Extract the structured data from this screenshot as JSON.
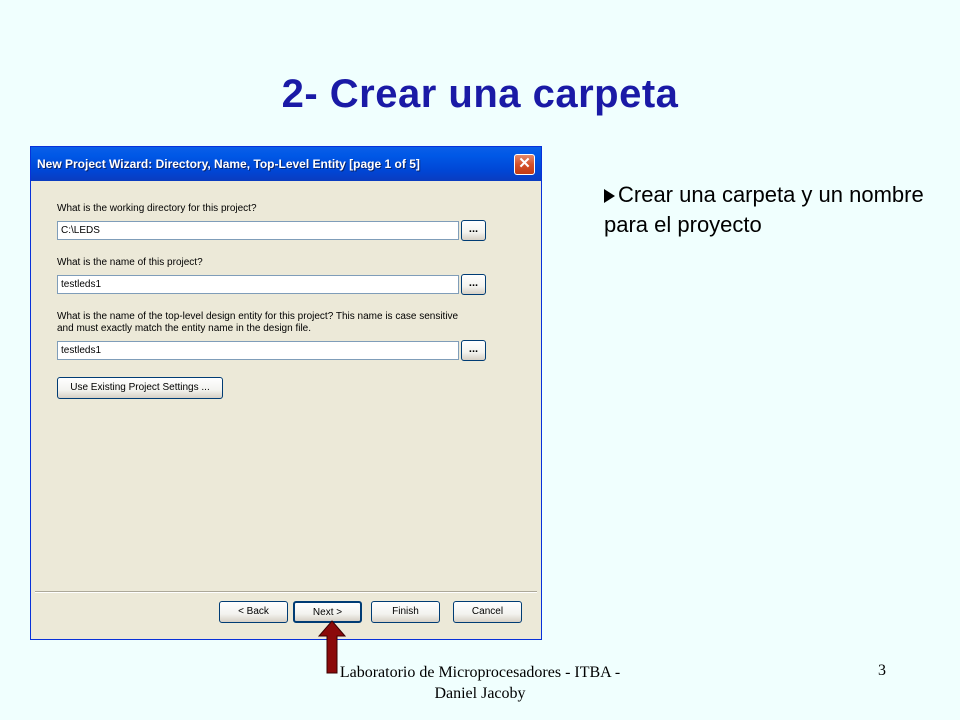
{
  "slide": {
    "title": "2- Crear una carpeta",
    "bullet": "Crear una carpeta y un nombre para el proyecto",
    "footer": "Laboratorio de Microprocesadores - ITBA -Daniel Jacoby",
    "page_number": "3"
  },
  "dialog": {
    "title": "New Project Wizard: Directory, Name, Top-Level Entity [page 1 of 5]",
    "close_symbol": "✕",
    "fields": [
      {
        "label": "What is the working directory for this project?",
        "value": "C:\\LEDS",
        "browse": "..."
      },
      {
        "label": "What is the name of this project?",
        "value": "testleds1",
        "browse": "..."
      },
      {
        "label_line1": "What is the name of the top-level design entity for this project? This name is case sensitive",
        "label_line2": "and must exactly match the entity name in the design file.",
        "value": "testleds1",
        "browse": "..."
      }
    ],
    "use_existing_label": "Use Existing Project Settings ...",
    "buttons": {
      "back": "< Back",
      "next": "Next >",
      "finish": "Finish",
      "cancel": "Cancel"
    }
  },
  "colors": {
    "title": "#1a1aa6",
    "arrow_fill": "#8b0a0a",
    "titlebar": "#0058e6"
  }
}
